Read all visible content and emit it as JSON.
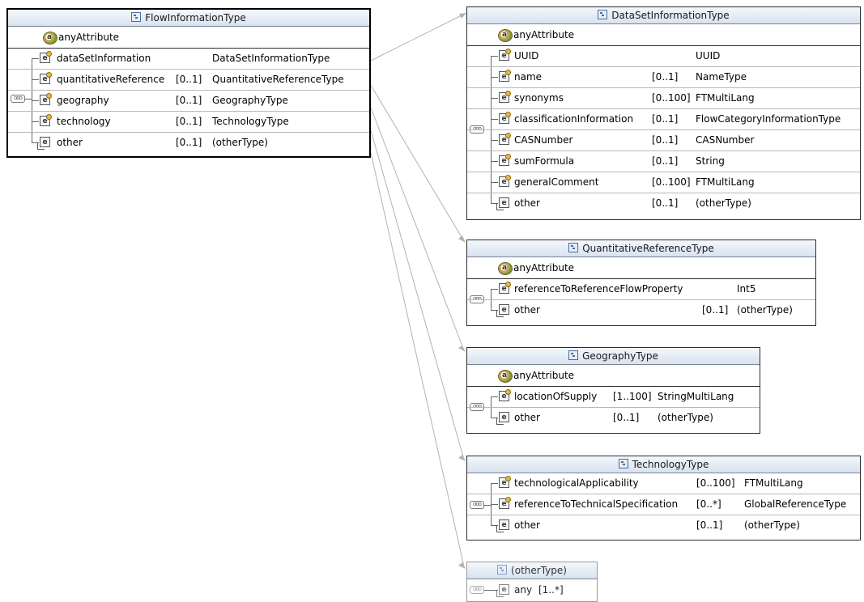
{
  "flow": {
    "title": "FlowInformationType",
    "attribute": "anyAttribute",
    "rows": [
      {
        "name": "dataSetInformation",
        "card": "",
        "type": "DataSetInformationType"
      },
      {
        "name": "quantitativeReference",
        "card": "[0..1]",
        "type": "QuantitativeReferenceType"
      },
      {
        "name": "geography",
        "card": "[0..1]",
        "type": "GeographyType"
      },
      {
        "name": "technology",
        "card": "[0..1]",
        "type": "TechnologyType"
      },
      {
        "name": "other",
        "card": "[0..1]",
        "type": "(otherType)"
      }
    ]
  },
  "dataset": {
    "title": "DataSetInformationType",
    "attribute": "anyAttribute",
    "rows": [
      {
        "name": "UUID",
        "card": "",
        "type": "UUID"
      },
      {
        "name": "name",
        "card": "[0..1]",
        "type": "NameType"
      },
      {
        "name": "synonyms",
        "card": "[0..100]",
        "type": "FTMultiLang"
      },
      {
        "name": "classificationInformation",
        "card": "[0..1]",
        "type": "FlowCategoryInformationType"
      },
      {
        "name": "CASNumber",
        "card": "[0..1]",
        "type": "CASNumber"
      },
      {
        "name": "sumFormula",
        "card": "[0..1]",
        "type": "String"
      },
      {
        "name": "generalComment",
        "card": "[0..100]",
        "type": "FTMultiLang"
      },
      {
        "name": "other",
        "card": "[0..1]",
        "type": "(otherType)"
      }
    ]
  },
  "quant": {
    "title": "QuantitativeReferenceType",
    "attribute": "anyAttribute",
    "rows": [
      {
        "name": "referenceToReferenceFlowProperty",
        "card": "",
        "type": "Int5"
      },
      {
        "name": "other",
        "card": "[0..1]",
        "type": "(otherType)"
      }
    ]
  },
  "geo": {
    "title": "GeographyType",
    "attribute": "anyAttribute",
    "rows": [
      {
        "name": "locationOfSupply",
        "card": "[1..100]",
        "type": "StringMultiLang"
      },
      {
        "name": "other",
        "card": "[0..1]",
        "type": "(otherType)"
      }
    ]
  },
  "tech": {
    "title": "TechnologyType",
    "rows": [
      {
        "name": "technologicalApplicability",
        "card": "[0..100]",
        "type": "FTMultiLang"
      },
      {
        "name": "referenceToTechnicalSpecification",
        "card": "[0..*]",
        "type": "GlobalReferenceType"
      },
      {
        "name": "other",
        "card": "[0..1]",
        "type": "(otherType)"
      }
    ]
  },
  "othertype": {
    "title": "(otherType)",
    "rows": [
      {
        "name": "any",
        "card": "[1..*]",
        "type": ""
      }
    ]
  },
  "colors": {
    "header_top": "#f4f8fd",
    "header_bottom": "#d8e2ef",
    "connector": "#b0b0b0"
  }
}
